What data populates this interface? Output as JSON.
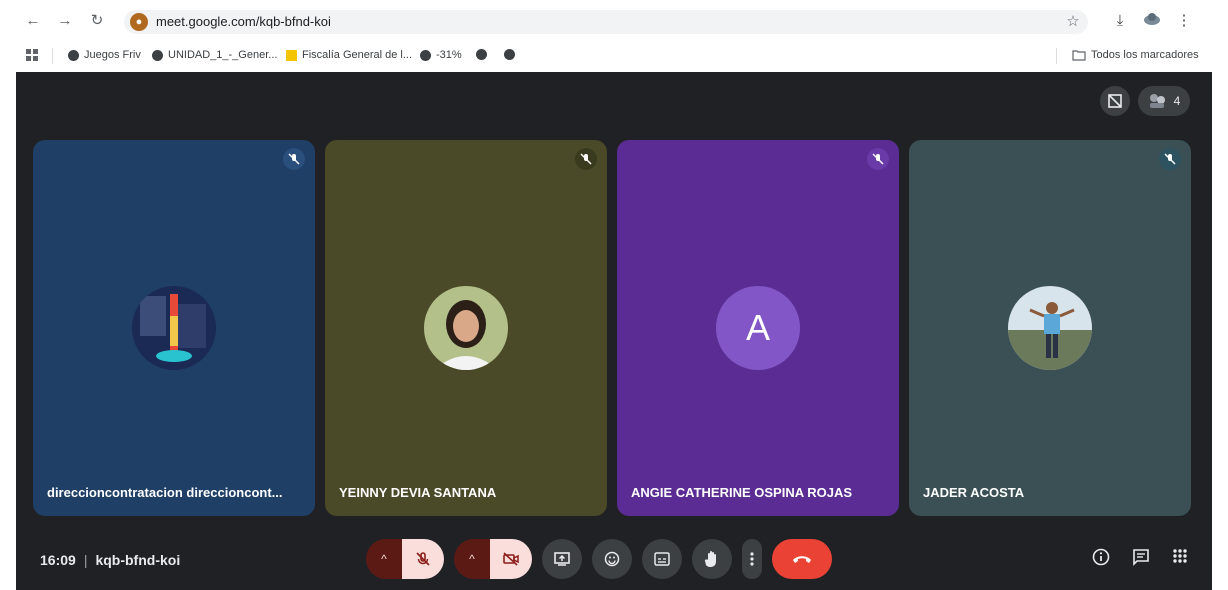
{
  "browser": {
    "url": "meet.google.com/kqb-bfnd-koi",
    "site_badge": "●",
    "back_glyph": "←",
    "forward_glyph": "→",
    "reload_glyph": "↻",
    "star_glyph": "☆",
    "download_glyph": "⤓",
    "menu_glyph": "⋮"
  },
  "bookmarks": {
    "items": [
      "Juegos Friv",
      "UNIDAD_1_-_Gener...",
      "Fiscalía General de l...",
      "-31%"
    ],
    "all_bookmarks": "Todos los marcadores"
  },
  "meet": {
    "participant_count": "4",
    "time": "16:09",
    "separator": "|",
    "meeting_code": "kqb-bfnd-koi",
    "participants": [
      {
        "name": "direccioncontratacion direccioncont...",
        "bg": "#1f3f66",
        "badge": "#2a4f7d"
      },
      {
        "name": "YEINNY DEVIA SANTANA",
        "bg": "#4b4a28",
        "badge": "#3a3a1e"
      },
      {
        "name": "ANGIE CATHERINE OSPINA ROJAS",
        "bg": "#5b2d94",
        "badge": "#6a3aa8",
        "initial": "A",
        "avatar_color": "#8256c6"
      },
      {
        "name": "JADER ACOSTA",
        "bg": "#3a5055",
        "badge": "#2d5360"
      }
    ],
    "hangup_color": "#ea4335"
  }
}
